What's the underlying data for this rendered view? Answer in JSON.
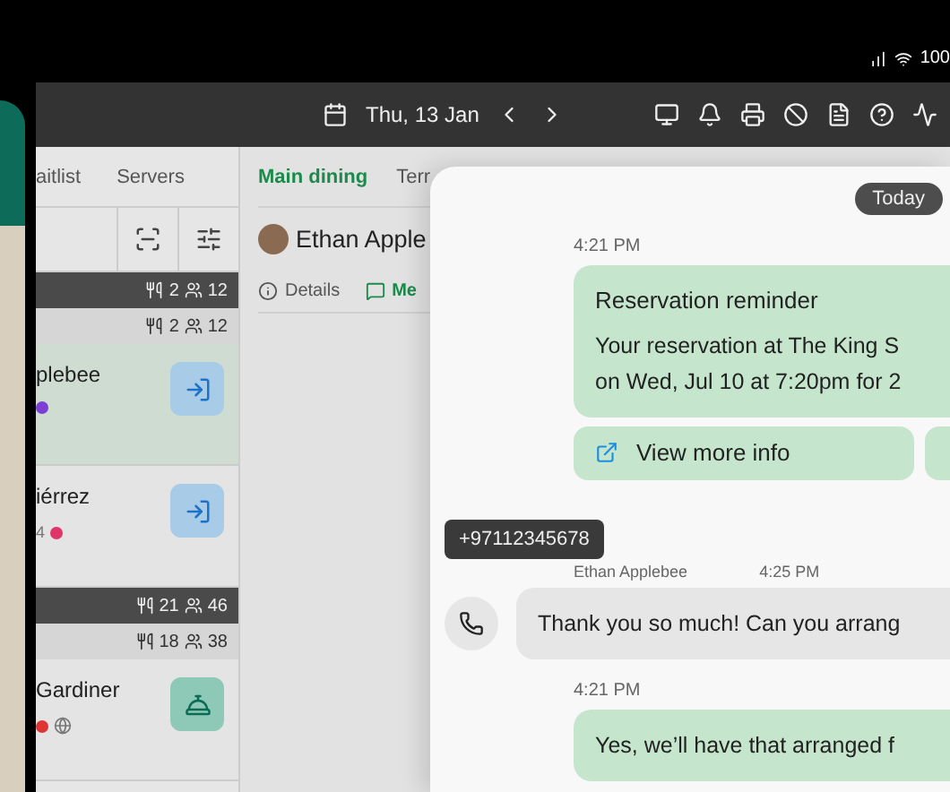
{
  "status_bar": {
    "battery": "100"
  },
  "toolbar": {
    "date": "Thu, 13 Jan"
  },
  "list_panel": {
    "tabs": [
      {
        "label": "aitlist",
        "selected": false
      },
      {
        "label": "Servers",
        "selected": false
      }
    ],
    "rows": [
      {
        "kind": "section",
        "dark": true,
        "tables": "2",
        "covers": "12"
      },
      {
        "kind": "section",
        "dark": false,
        "tables": "2",
        "covers": "12"
      },
      {
        "kind": "reservation",
        "name": "plebee",
        "selected": true,
        "served": false,
        "color": "#7b3fd4"
      },
      {
        "kind": "reservation",
        "name": "iérrez",
        "detail": "4",
        "selected": false,
        "served": false,
        "color": "#e0356b"
      },
      {
        "kind": "section",
        "dark": true,
        "tables": "21",
        "covers": "46"
      },
      {
        "kind": "section",
        "dark": false,
        "tables": "18",
        "covers": "38"
      },
      {
        "kind": "reservation",
        "name": "Gardiner",
        "selected": false,
        "served": true,
        "color": "#e03535"
      }
    ]
  },
  "detail_panel": {
    "tabs": [
      {
        "label": "Main dining",
        "selected": true
      },
      {
        "label": "Terr",
        "selected": false
      }
    ],
    "guest": "Ethan Apple",
    "subtabs": [
      {
        "label": "Details",
        "selected": false
      },
      {
        "label": "Me",
        "selected": true
      }
    ]
  },
  "chat": {
    "date_chip": "Today",
    "tooltip": "+97112345678",
    "messages": [
      {
        "kind": "template",
        "time": "4:21 PM",
        "title": "Reservation reminder",
        "lines": [
          "Your reservation at The King S",
          "on Wed, Jul 10 at 7:20pm for 2"
        ],
        "button": "View more info"
      },
      {
        "kind": "incoming",
        "sender": "Ethan Applebee",
        "time": "4:25 PM",
        "text": "Thank you so much! Can you arrang"
      },
      {
        "kind": "outgoing",
        "time": "4:21 PM",
        "text": "Yes, we’ll have that arranged f"
      }
    ]
  }
}
